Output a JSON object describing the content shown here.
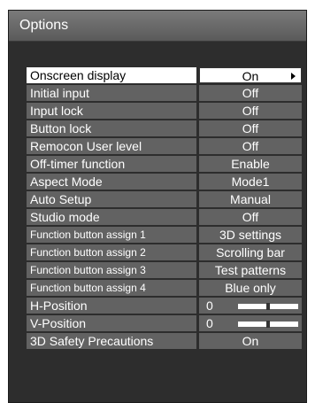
{
  "window": {
    "title": "Options"
  },
  "menu": {
    "items": [
      {
        "label": "Onscreen display",
        "value": "On",
        "selected": true,
        "small": false
      },
      {
        "label": "Initial input",
        "value": "Off",
        "small": false
      },
      {
        "label": "Input lock",
        "value": "Off",
        "small": false
      },
      {
        "label": "Button lock",
        "value": "Off",
        "small": false
      },
      {
        "label": "Remocon User level",
        "value": "Off",
        "small": false
      },
      {
        "label": "Off-timer function",
        "value": "Enable",
        "small": false
      },
      {
        "label": "Aspect Mode",
        "value": "Mode1",
        "small": false
      },
      {
        "label": "Auto Setup",
        "value": "Manual",
        "small": false
      },
      {
        "label": "Studio mode",
        "value": "Off",
        "small": false
      },
      {
        "label": "Function button assign 1",
        "value": "3D settings",
        "small": true
      },
      {
        "label": "Function button assign 2",
        "value": "Scrolling bar",
        "small": true
      },
      {
        "label": "Function button assign 3",
        "value": "Test patterns",
        "small": true
      },
      {
        "label": "Function button assign 4",
        "value": "Blue only",
        "small": true
      },
      {
        "label": "H-Position",
        "value": "0",
        "slider_fraction": 0.5,
        "small": false
      },
      {
        "label": "V-Position",
        "value": "0",
        "slider_fraction": 0.5,
        "small": false
      },
      {
        "label": "3D Safety Precautions",
        "value": "On",
        "small": false
      }
    ]
  },
  "colors": {
    "row_bg": "#626262",
    "selected_bg": "#ffffff",
    "frame_bg": "#2d2d2d",
    "text": "#ffffff"
  }
}
